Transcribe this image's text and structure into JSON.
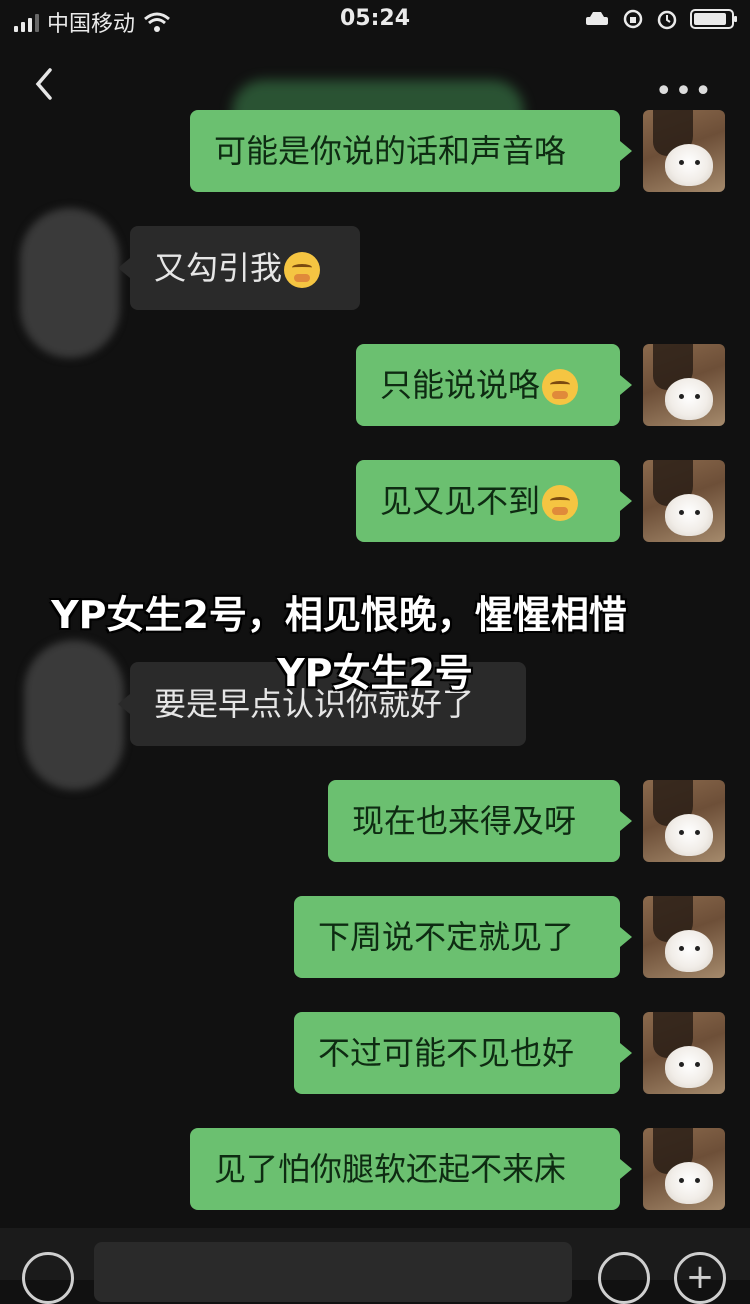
{
  "status": {
    "carrier": "中国移动",
    "time": "05:24"
  },
  "nav": {
    "more": "•••"
  },
  "messages": [
    {
      "side": "out",
      "text": "可能是你说的话和声音咯",
      "emoji": false
    },
    {
      "side": "in",
      "text": "又勾引我",
      "emoji": true
    },
    {
      "side": "out",
      "text": "只能说说咯",
      "emoji": true
    },
    {
      "side": "out",
      "text": "见又见不到",
      "emoji": true
    },
    {
      "side": "in",
      "text": "要是早点认识你就好了",
      "emoji": false
    },
    {
      "side": "out",
      "text": "现在也来得及呀",
      "emoji": false
    },
    {
      "side": "out",
      "text": "下周说不定就见了",
      "emoji": false
    },
    {
      "side": "out",
      "text": "不过可能不见也好",
      "emoji": false
    },
    {
      "side": "out",
      "text": "见了怕你腿软还起不来床",
      "emoji": false
    }
  ],
  "overlay": {
    "line1": "YP女生2号，相见恨晚，惺惺相惜",
    "line2": "YP女生2号"
  },
  "colors": {
    "background": "#111111",
    "bubble_out": "#6bc070",
    "bubble_in": "#2a2a2a"
  }
}
